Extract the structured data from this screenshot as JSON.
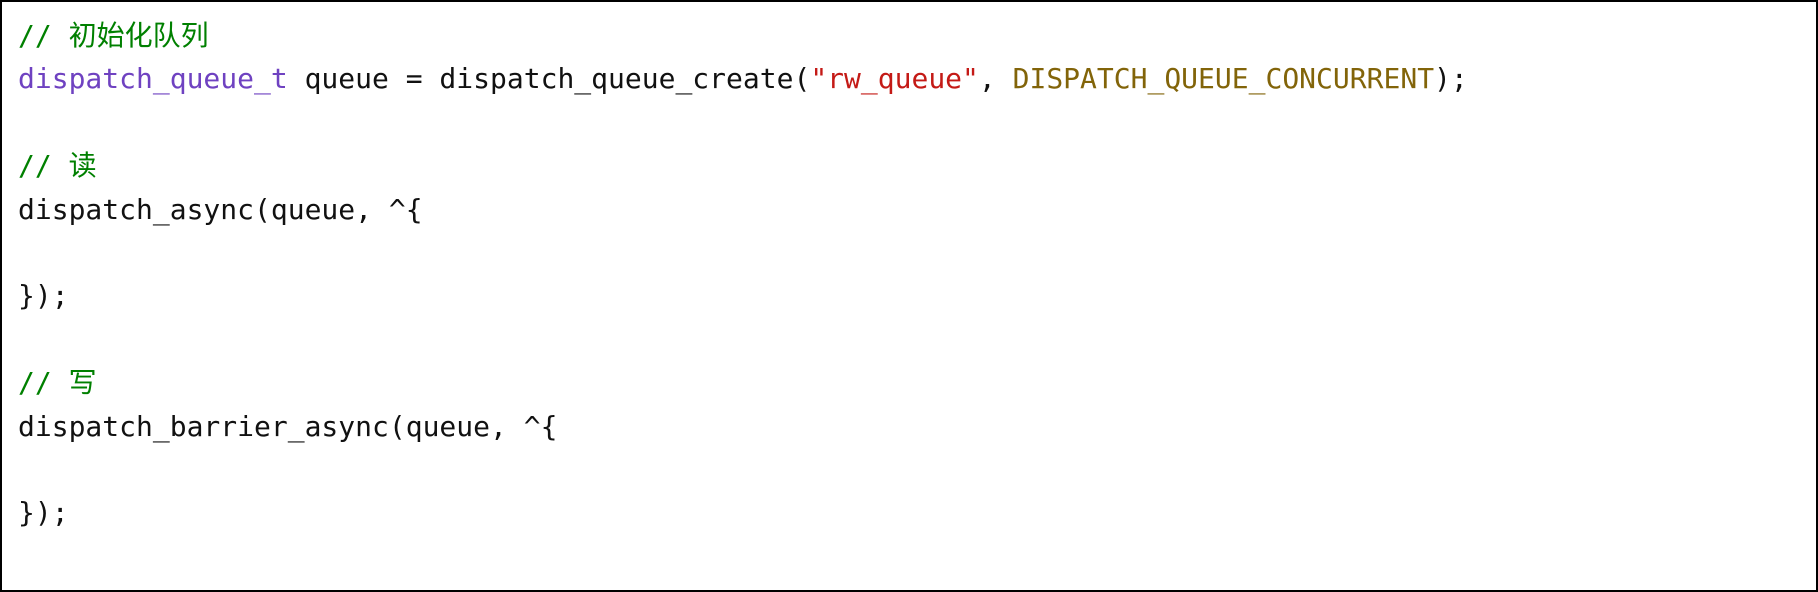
{
  "code": {
    "line1": {
      "commentPrefix": "// ",
      "commentText": "初始化队列"
    },
    "line2": {
      "type": "dispatch_queue_t",
      "varAndAssign": " queue = dispatch_queue_create(",
      "stringLiteral": "\"rw_queue\"",
      "afterString": ", ",
      "constant": "DISPATCH_QUEUE_CONCURRENT",
      "end": ");"
    },
    "blank1": " ",
    "line4": {
      "commentPrefix": "// ",
      "commentText": "读"
    },
    "line5": "dispatch_async(queue, ^{",
    "line6": "    ",
    "line7": "});",
    "blank2": " ",
    "line9": {
      "commentPrefix": "// ",
      "commentText": "写"
    },
    "line10": "dispatch_barrier_async(queue, ^{",
    "line11": "    ",
    "line12": "});"
  }
}
